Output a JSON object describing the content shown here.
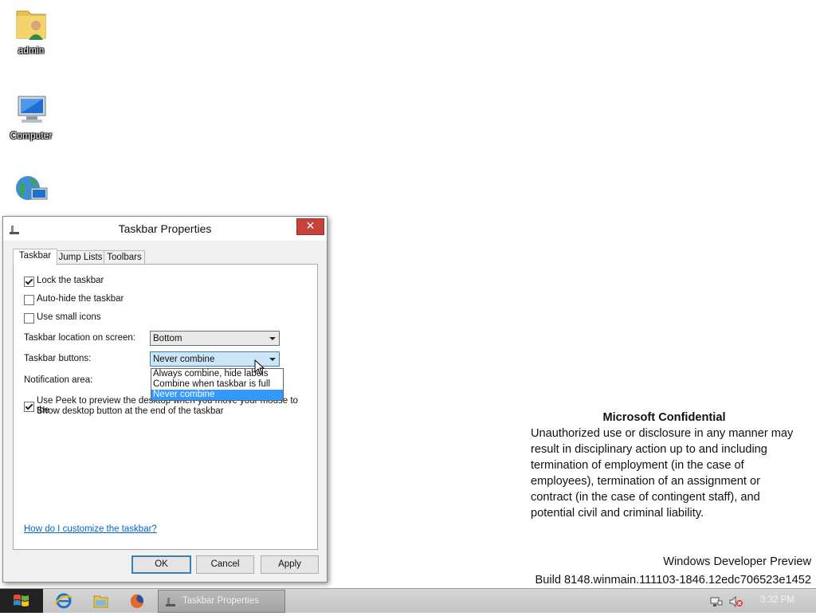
{
  "desktop": {
    "icons": [
      {
        "label": "admin",
        "icon": "user-folder-icon"
      },
      {
        "label": "Computer",
        "icon": "computer-icon"
      },
      {
        "label": "",
        "icon": "network-globe-icon"
      }
    ]
  },
  "watermark": {
    "title": "Microsoft Confidential",
    "lines": [
      "Unauthorized use or disclosure in any manner may",
      "result in disciplinary action up to and including",
      "termination of employment (in the case of",
      "employees), termination of an assignment or",
      "contract (in the case of contingent staff), and",
      "potential civil and criminal liability."
    ],
    "product": "Windows Developer Preview",
    "build": "Build 8148.winmain.111103-1846.12edc706523e1452"
  },
  "dialog": {
    "title": "Taskbar Properties",
    "close_label": "✕",
    "tabs": [
      {
        "label": "Taskbar",
        "active": true
      },
      {
        "label": "Jump Lists",
        "active": false
      },
      {
        "label": "Toolbars",
        "active": false
      }
    ],
    "checkboxes": {
      "lock": {
        "label": "Lock the taskbar",
        "checked": true
      },
      "autohide": {
        "label": "Auto-hide the taskbar",
        "checked": false
      },
      "small_icons": {
        "label": "Use small icons",
        "checked": false
      },
      "peek_line1": "Use Peek to preview the desktop when you move your mouse to the",
      "peek_line2": "Show desktop button at the end of the taskbar",
      "peek_checked": true
    },
    "location": {
      "label": "Taskbar location on screen:",
      "value": "Bottom"
    },
    "buttons_combine": {
      "label": "Taskbar buttons:",
      "value": "Never combine",
      "options": [
        "Always combine, hide labels",
        "Combine when taskbar is full",
        "Never combine"
      ],
      "selected_index": 2
    },
    "notification": {
      "label": "Notification area:"
    },
    "help_link": "How do I customize the taskbar?",
    "ok_label": "OK",
    "cancel_label": "Cancel",
    "apply_label": "Apply"
  },
  "taskbar": {
    "active_task": "Taskbar Properties",
    "clock": "3:32 PM",
    "pinned": [
      "internet-explorer-icon",
      "file-explorer-icon",
      "firefox-icon"
    ]
  }
}
